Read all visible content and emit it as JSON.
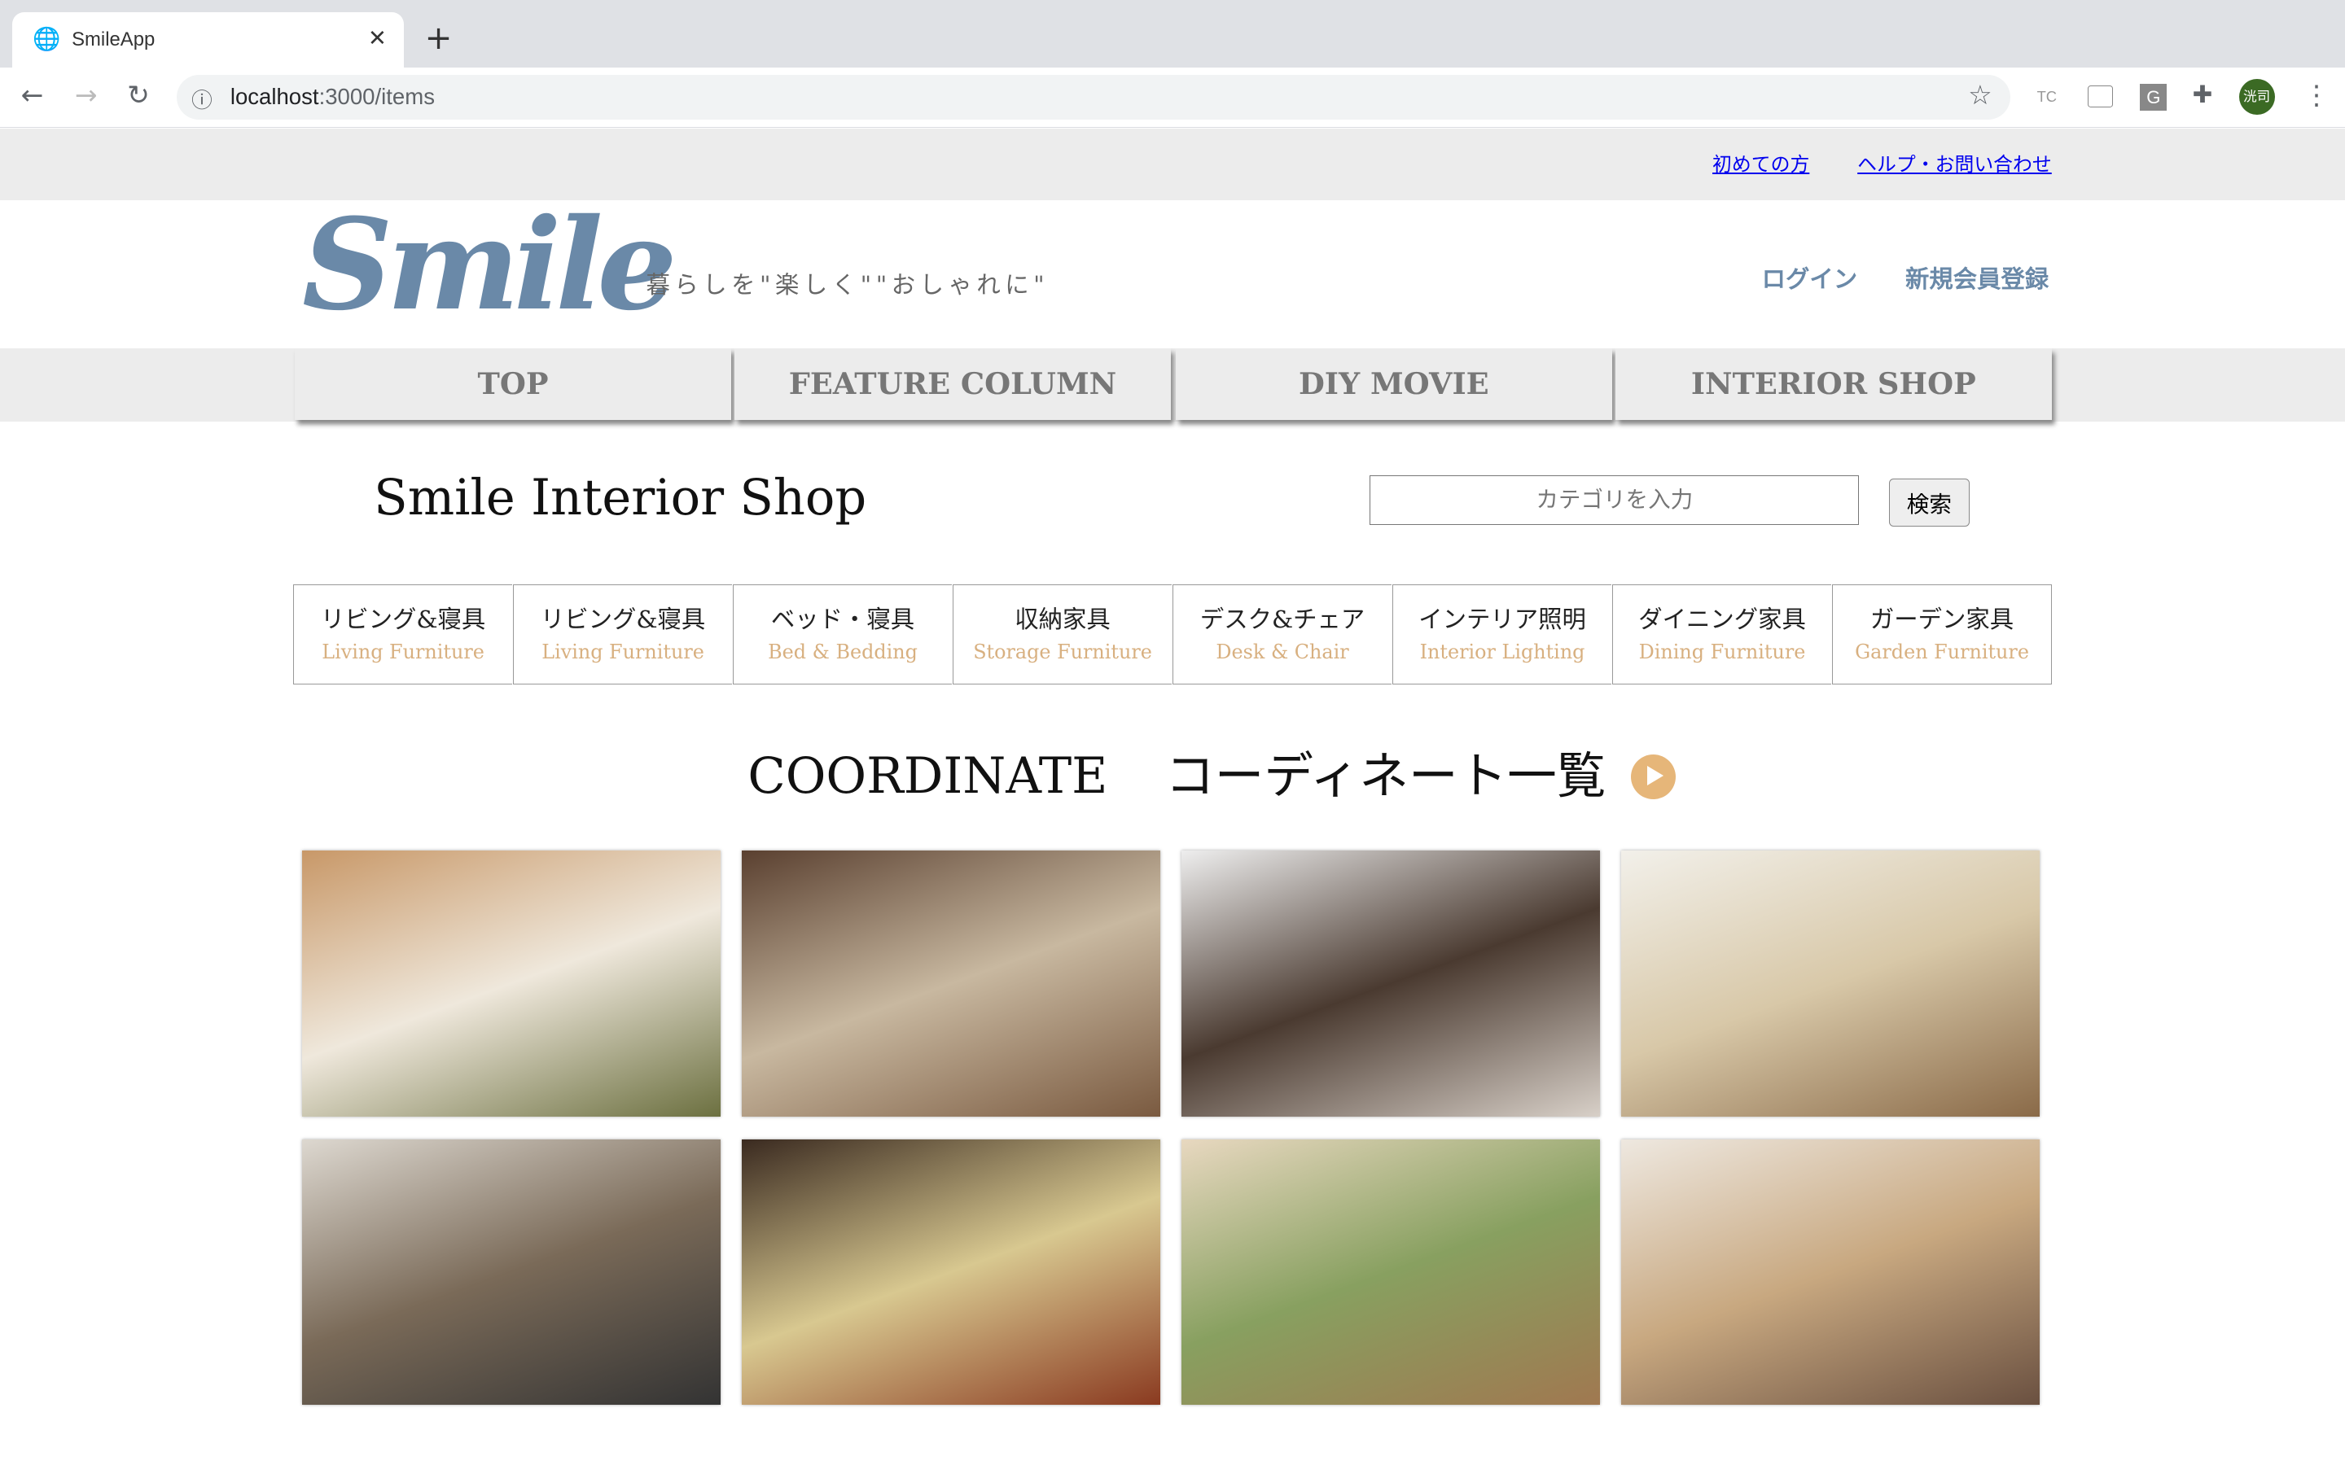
{
  "browser": {
    "tab_title": "SmileApp",
    "url_host": "localhost",
    "url_path": ":3000/items",
    "profile_initials": "洸司",
    "ext_tc": "TC",
    "ext_g": "G"
  },
  "topbar": {
    "links": [
      "初めての方",
      "ヘルプ・お問い合わせ"
    ]
  },
  "header": {
    "logo": "Smile",
    "tagline": "暮らしを\"楽しく\"\"おしゃれに\"",
    "login": "ログイン",
    "signup": "新規会員登録"
  },
  "nav": [
    "TOP",
    "FEATURE COLUMN",
    "DIY MOVIE",
    "INTERIOR SHOP"
  ],
  "main": {
    "title": "Smile Interior Shop",
    "search_placeholder": "カテゴリを入力",
    "search_button": "検索"
  },
  "categories": [
    {
      "jp": "リビング&寝具",
      "en": "Living Furniture"
    },
    {
      "jp": "リビング&寝具",
      "en": "Living Furniture"
    },
    {
      "jp": "ベッド・寝具",
      "en": "Bed & Bedding"
    },
    {
      "jp": "収納家具",
      "en": "Storage Furniture"
    },
    {
      "jp": "デスク&チェア",
      "en": "Desk & Chair"
    },
    {
      "jp": "インテリア照明",
      "en": "Interior Lighting"
    },
    {
      "jp": "ダイニング家具",
      "en": "Dining Furniture"
    },
    {
      "jp": "ガーデン家具",
      "en": "Garden Furniture"
    }
  ],
  "coordinate": {
    "title_en": "COORDINATE",
    "title_jp": "コーディネート一覧",
    "accent": "#e6b679"
  },
  "colors": {
    "logo": "#6a89a8",
    "category_en": "#d8b080",
    "link": "#0000ee"
  }
}
